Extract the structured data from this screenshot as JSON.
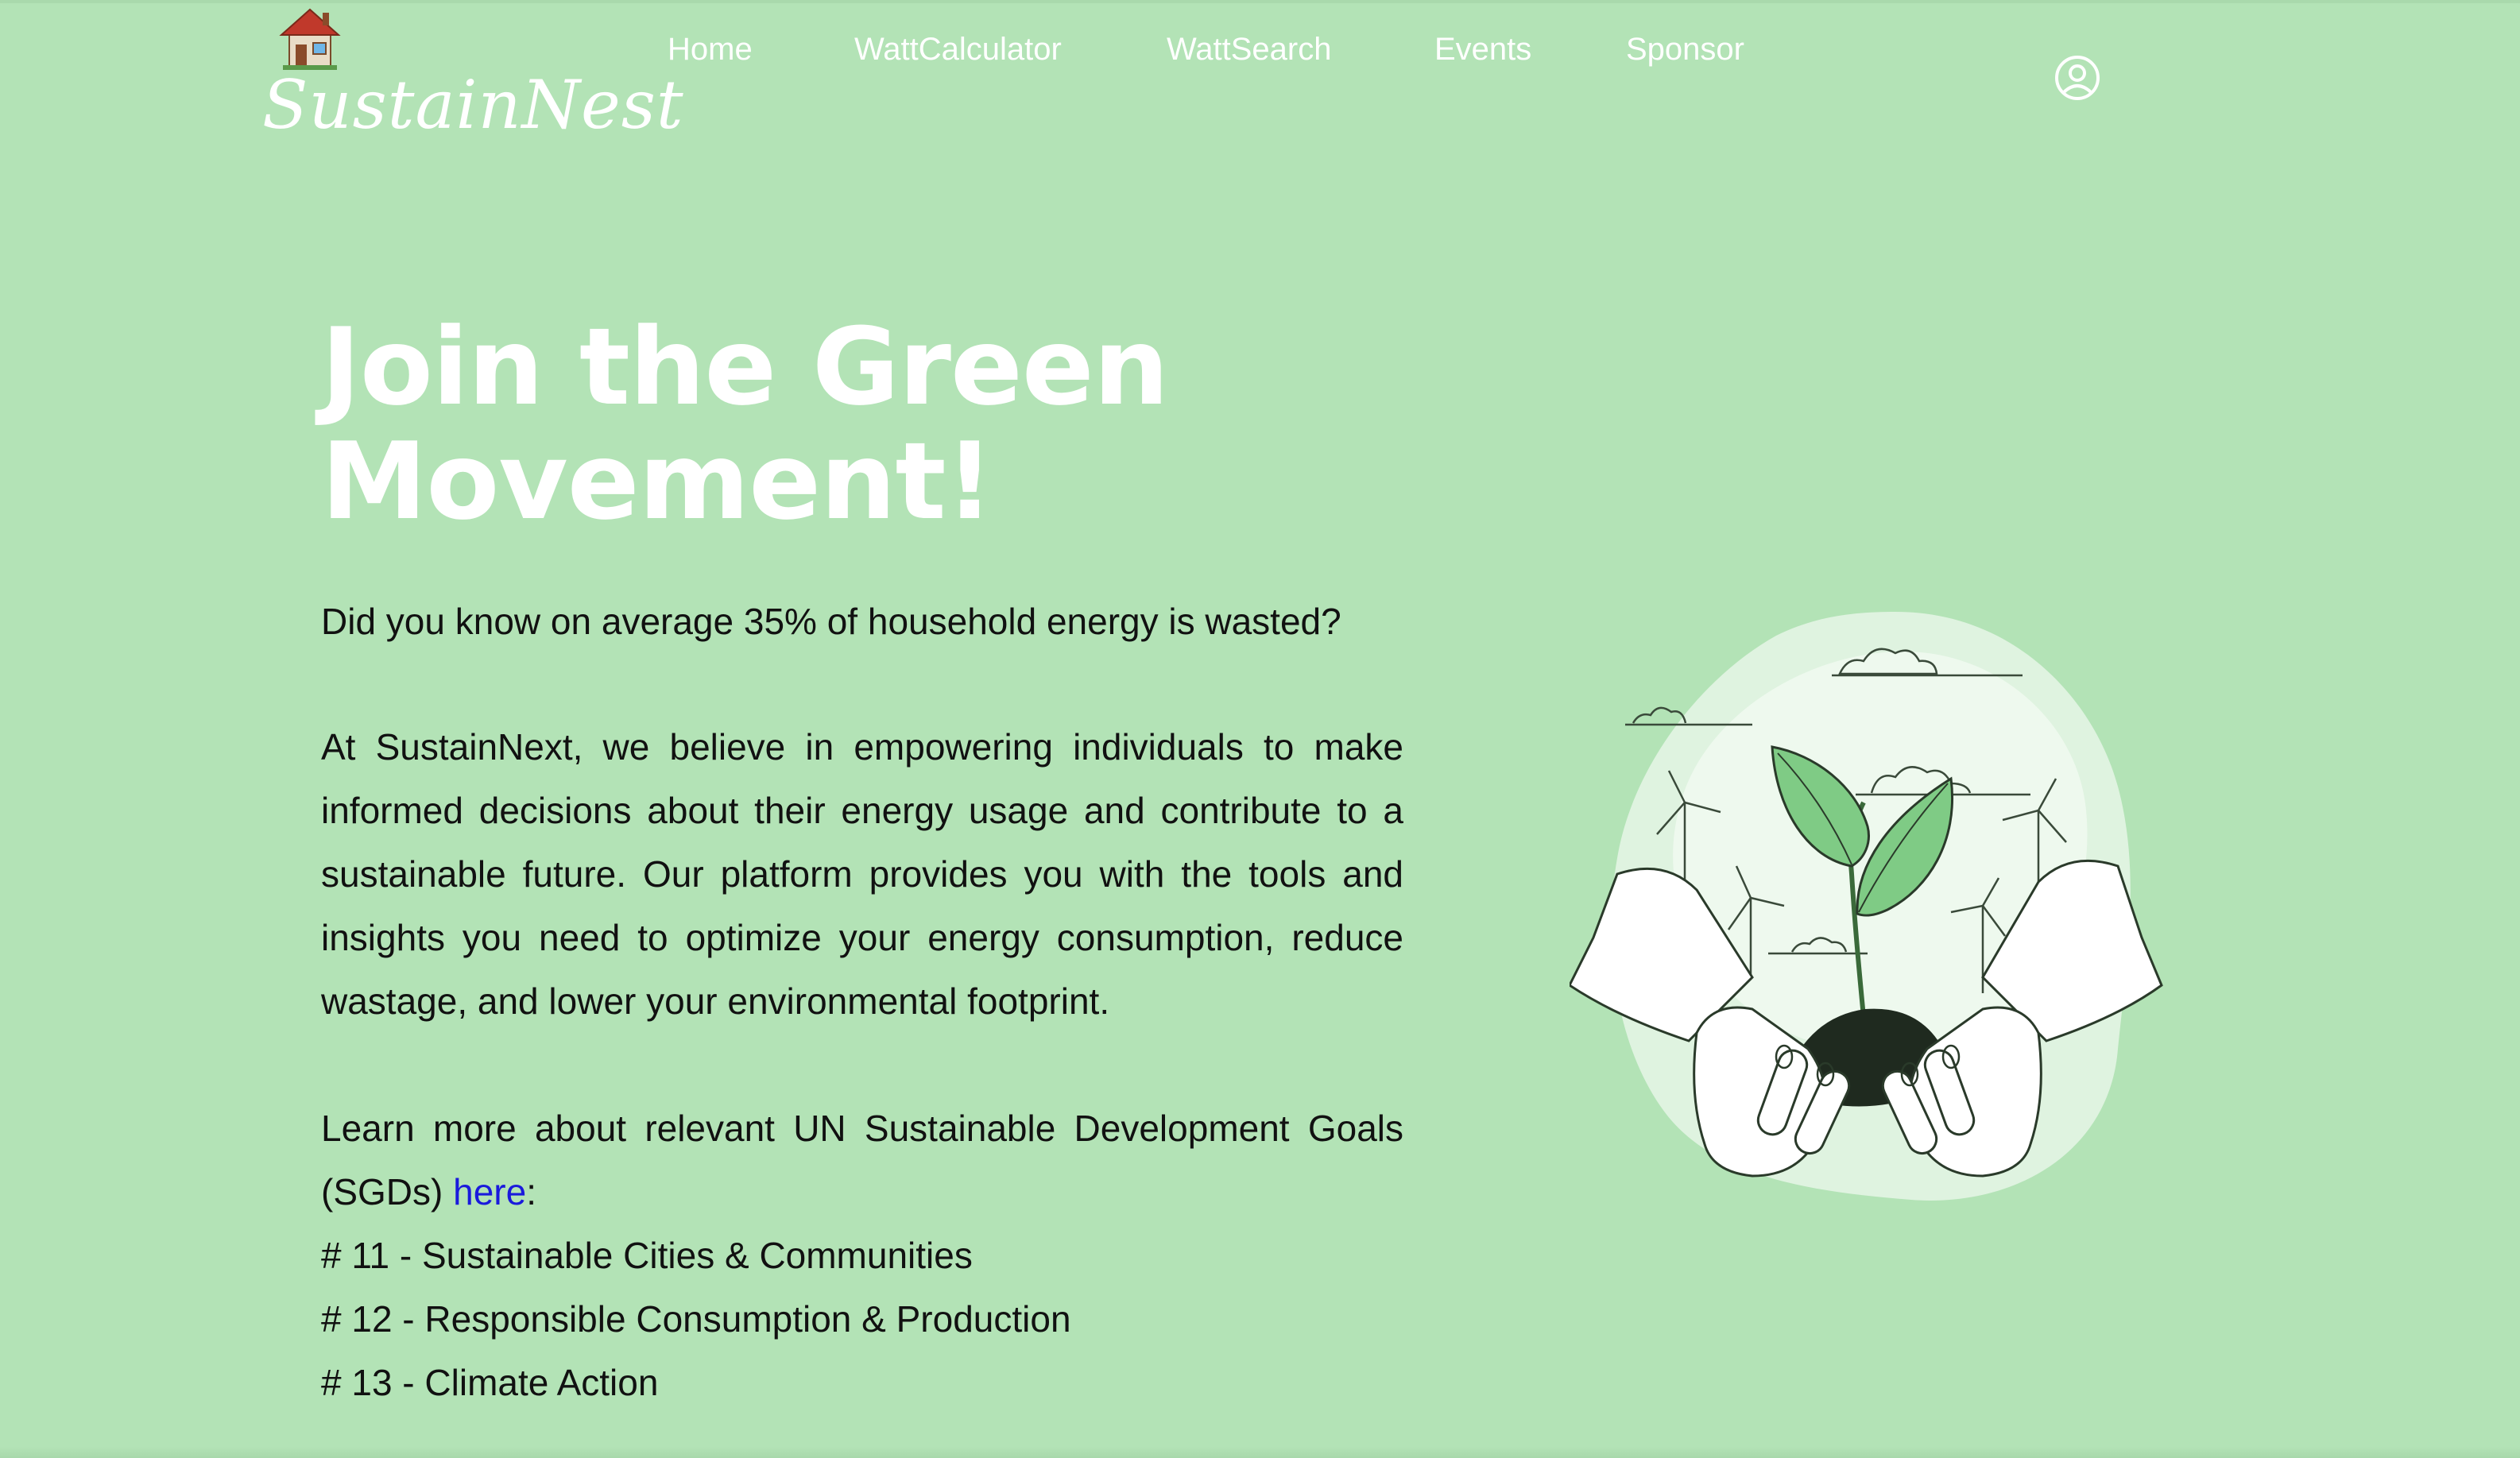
{
  "header": {
    "logo_text": "SustainNest",
    "logo_icon": "house-icon",
    "nav": [
      {
        "label": "Home"
      },
      {
        "label": "WattCalculator"
      },
      {
        "label": "WattSearch"
      },
      {
        "label": "Events"
      },
      {
        "label": "Sponsor"
      }
    ],
    "account_icon": "user-circle-icon"
  },
  "hero": {
    "title_line1": "Join the Green",
    "title_line2": "Movement!",
    "intro": "Did you know on average 35% of household energy is wasted?",
    "paragraph": "At SustainNext, we believe in empowering individuals to make informed decisions about their energy usage and contribute to a sustainable future. Our platform provides you with the tools and insights you need to optimize your energy consumption, reduce wastage, and lower your environmental footprint.",
    "learn_prefix": "Learn more about relevant UN Sustainable Development Goals (SGDs) ",
    "learn_link": "here",
    "learn_suffix": ":",
    "goals": [
      "# 11 - Sustainable Cities & Communities",
      "# 12 - Responsible Consumption & Production",
      "# 13 - Climate Action"
    ]
  },
  "colors": {
    "background": "#b3e3b6",
    "link": "#1a1adc",
    "text": "#111111",
    "heading": "#ffffff"
  }
}
